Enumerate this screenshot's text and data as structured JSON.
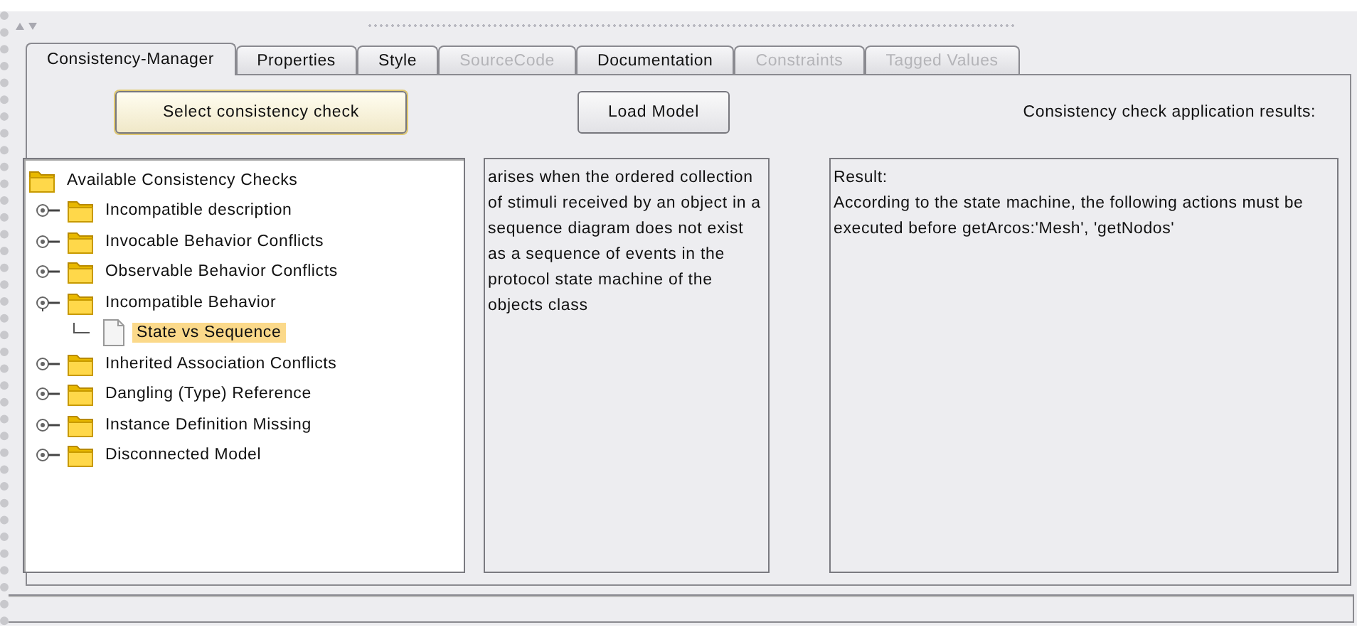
{
  "tabs": [
    {
      "label": "Consistency-Manager",
      "selected": true,
      "disabled": false
    },
    {
      "label": "Properties",
      "selected": false,
      "disabled": false
    },
    {
      "label": "Style",
      "selected": false,
      "disabled": false
    },
    {
      "label": "SourceCode",
      "selected": false,
      "disabled": true
    },
    {
      "label": "Documentation",
      "selected": false,
      "disabled": false
    },
    {
      "label": "Constraints",
      "selected": false,
      "disabled": true
    },
    {
      "label": "Tagged Values",
      "selected": false,
      "disabled": true
    }
  ],
  "buttons": [
    {
      "label": "Select consistency check",
      "kind": "focused"
    },
    {
      "label": "Load Model",
      "kind": "plain"
    }
  ],
  "results_heading": "Consistency check application results:",
  "tree": {
    "label": "Available Consistency Checks",
    "selected": false,
    "kind": "folder",
    "children": [
      {
        "label": "Incompatible description",
        "kind": "folder",
        "expanded": false,
        "selected": false
      },
      {
        "label": "Invocable Behavior Conflicts",
        "kind": "folder",
        "expanded": false,
        "selected": false
      },
      {
        "label": "Observable Behavior Conflicts",
        "kind": "folder",
        "expanded": false,
        "selected": false
      },
      {
        "label": "Incompatible Behavior",
        "kind": "folder",
        "expanded": true,
        "selected": false,
        "children": [
          {
            "label": "State vs Sequence",
            "kind": "leaf",
            "selected": true
          }
        ]
      },
      {
        "label": "Inherited Association Conflicts",
        "kind": "folder",
        "expanded": false,
        "selected": false
      },
      {
        "label": "Dangling (Type) Reference",
        "kind": "folder",
        "expanded": false,
        "selected": false
      },
      {
        "label": "Instance Definition Missing",
        "kind": "folder",
        "expanded": false,
        "selected": false
      },
      {
        "label": "Disconnected Model",
        "kind": "folder",
        "expanded": false,
        "selected": false
      }
    ]
  },
  "description": "arises when the ordered collection of stimuli received by an object in a sequence diagram does not exist as a sequence of events in the protocol state machine of the objects class",
  "result": {
    "title": "Result:",
    "text": "According to the state machine, the following actions must be executed before getArcos:'Mesh', 'getNodos'"
  }
}
